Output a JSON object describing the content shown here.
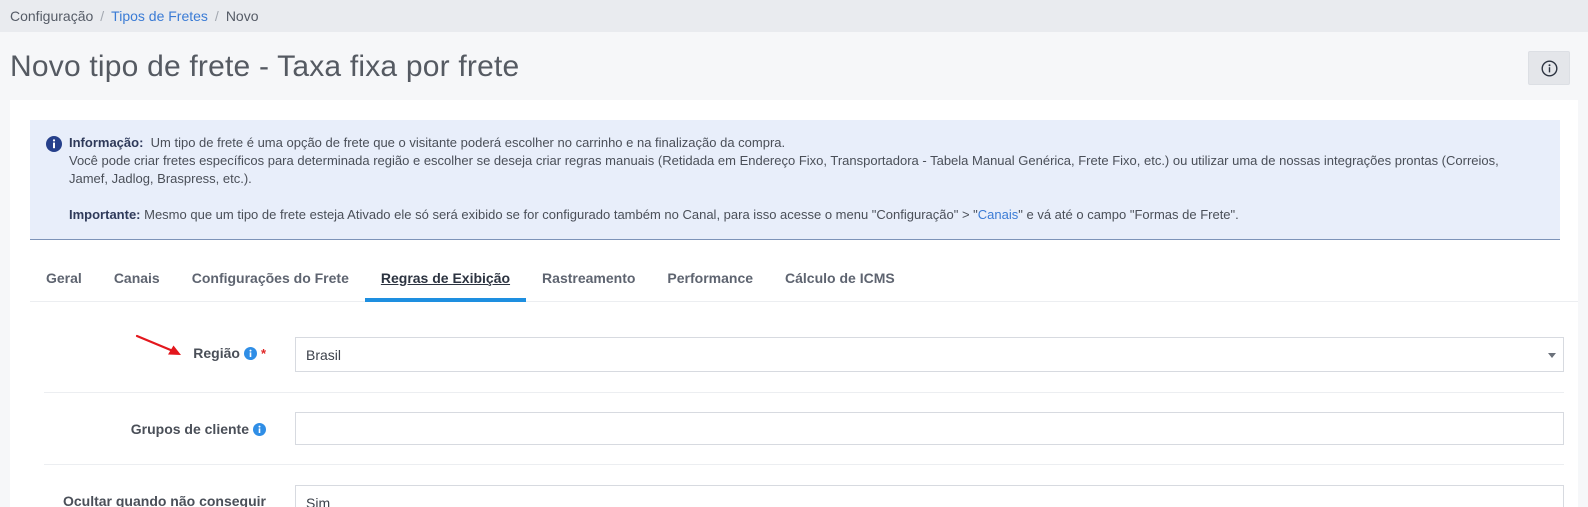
{
  "breadcrumb": {
    "items": [
      "Configuração",
      "Tipos de Fretes",
      "Novo"
    ],
    "separator": "/"
  },
  "page": {
    "title": "Novo tipo de frete - Taxa fixa por frete"
  },
  "alert": {
    "info_label": "Informação:",
    "info_line1": "Um tipo de frete é uma opção de frete que o visitante poderá escolher no carrinho e na finalização da compra.",
    "info_line2": "Você pode criar fretes específicos para determinada região e escolher se deseja criar regras manuais (Retidada em Endereço Fixo, Transportadora - Tabela Manual Genérica, Frete Fixo, etc.) ou utilizar uma de nossas integrações prontas (Correios, Jamef, Jadlog, Braspress, etc.).",
    "important_label": "Importante:",
    "important_text_a": "Mesmo que um tipo de frete esteja Ativado ele só será exibido se for configurado também no Canal, para isso acesse o menu \"Configuração\" > \"",
    "important_link": "Canais",
    "important_text_b": "\" e vá até o campo \"Formas de Frete\"."
  },
  "tabs": [
    {
      "label": "Geral"
    },
    {
      "label": "Canais"
    },
    {
      "label": "Configurações do Frete"
    },
    {
      "label": "Regras de Exibição"
    },
    {
      "label": "Rastreamento"
    },
    {
      "label": "Performance"
    },
    {
      "label": "Cálculo de ICMS"
    }
  ],
  "active_tab": "Regras de Exibição",
  "form": {
    "regiao": {
      "label": "Região",
      "required_mark": "*",
      "value": "Brasil"
    },
    "grupos": {
      "label": "Grupos de cliente",
      "value": ""
    },
    "ocultar": {
      "label": "Ocultar quando não conseguir",
      "value": "Sim"
    }
  },
  "colors": {
    "accent": "#1e8fe0",
    "link": "#3a7bd5",
    "alert_bg": "#e8eefa",
    "required": "#e02525",
    "annotation_arrow": "#e3171d"
  },
  "icons": [
    "info-circle-icon",
    "info-dot-icon",
    "chevron-down-icon",
    "red-arrow-annotation"
  ]
}
